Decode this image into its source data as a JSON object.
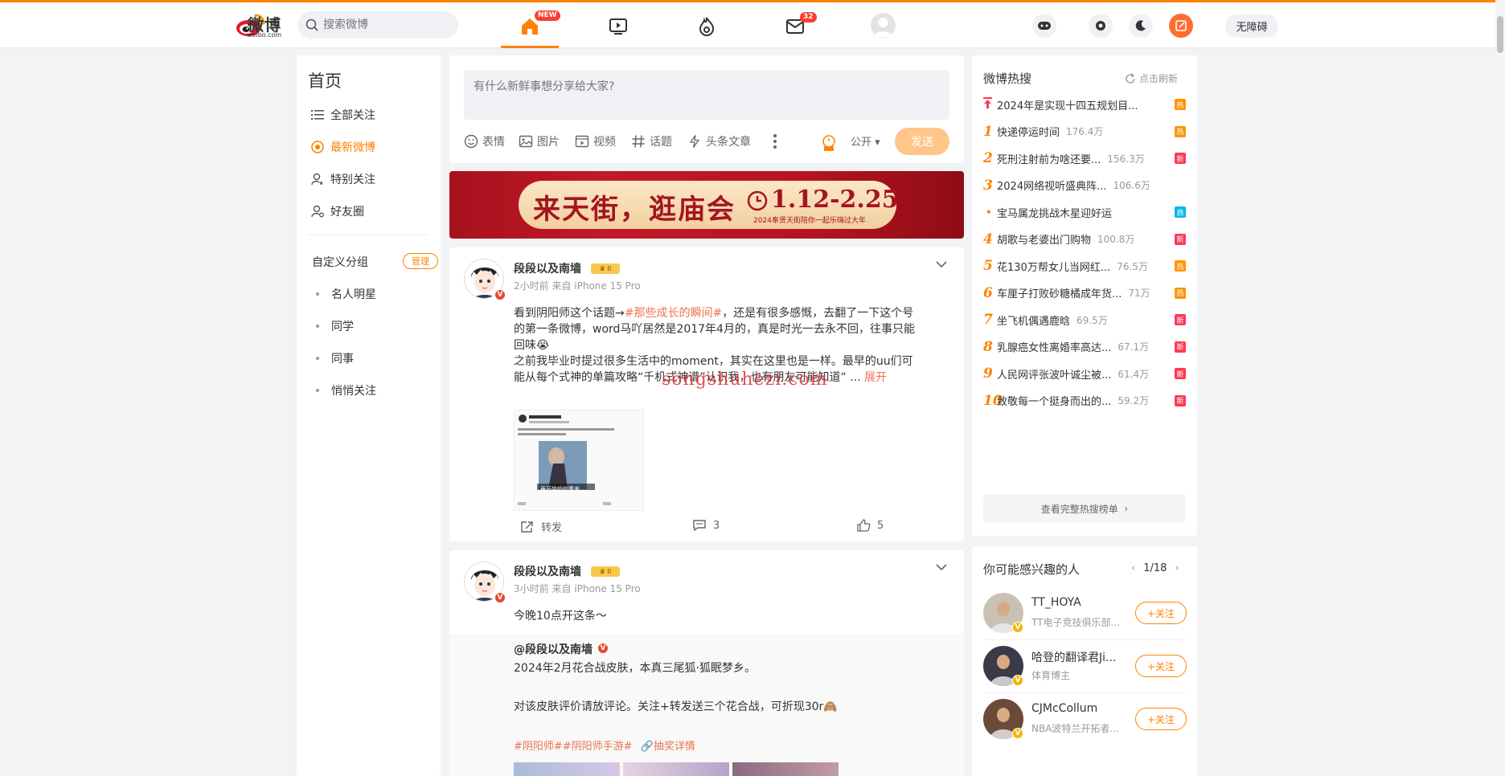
{
  "nav": {
    "logo_text": "微博",
    "logo_sub": "weibo.com",
    "search_placeholder": "搜索微博",
    "home_badge": "NEW",
    "mail_badge": "32",
    "accessibility": "无障碍"
  },
  "left": {
    "title": "首页",
    "menu": [
      {
        "label": "全部关注",
        "icon": "list-icon"
      },
      {
        "label": "最新微博",
        "icon": "latest-icon",
        "active": true
      },
      {
        "label": "特别关注",
        "icon": "user-star-icon"
      },
      {
        "label": "好友圈",
        "icon": "user-friends-icon"
      }
    ],
    "custom_group": "自定义分组",
    "manage": "管理",
    "groups": [
      "名人明星",
      "同学",
      "同事",
      "悄悄关注"
    ]
  },
  "composer": {
    "placeholder": "有什么新鲜事想分享给大家?",
    "tools": [
      "表情",
      "图片",
      "视频",
      "话题",
      "头条文章"
    ],
    "visibility": "公开",
    "send": "发送"
  },
  "banner": {
    "title": "来天街，逛庙会",
    "date": "1.12-2.25",
    "sub": "2024奉贤天街陪你一起乐嗨过大年"
  },
  "posts": [
    {
      "name": "段段以及南墙",
      "meta": "2小时前  来自 iPhone 15 Pro",
      "line1_pre": "看到阴阳师这个话题→",
      "line1_tag": "#那些成长的瞬间#",
      "line1_post": "，还是有很多感慨，去翻了一下这个号",
      "line2": "的第一条微博，word马吖居然是2017年4月的，真是时光一去永不回，往事只能",
      "line3": "回味😭",
      "line4": "之前我毕业时提过很多生活中的moment，其实在这里也是一样。最早的uu们可",
      "line5": "能从每个式神的单篇攻略“千机式神谱”认识我，也有朋友可能知道“ ...",
      "expand": "展开",
      "image_caption": "再开始炉炉重来",
      "repost": "转发",
      "comments": "3",
      "likes": "5"
    },
    {
      "name": "段段以及南墙",
      "meta": "3小时前  来自 iPhone 15 Pro",
      "text": "今晚10点开这条～",
      "quoted_name": "@段段以及南墙",
      "quoted_line1": "2024年2月花合战皮肤，本真三尾狐·狐眠梦乡。",
      "quoted_line2": "对该皮肤评价请放评论。关注+转发送三个花合战，可折现30r🙈",
      "quoted_tags": "#阴阳师##阴阳师手游#",
      "quoted_link": "抽奖详情"
    }
  ],
  "hot_search": {
    "title": "微博热搜",
    "refresh": "点击刷新",
    "items": [
      {
        "rank": "",
        "title": "2024年是实现十四五规划目...",
        "count": "",
        "tag": "热",
        "tag_color": "#ff9406"
      },
      {
        "rank": "1",
        "title": "快递停运时间",
        "count": "176.4万",
        "tag": "热",
        "tag_color": "#ff9406"
      },
      {
        "rank": "2",
        "title": "死刑注射前为啥还要...",
        "count": "156.3万",
        "tag": "新",
        "tag_color": "#ff3852"
      },
      {
        "rank": "3",
        "title": "2024网络视听盛典阵...",
        "count": "106.6万",
        "tag": "",
        "tag_color": ""
      },
      {
        "rank": "•",
        "title": "宝马属龙挑战木星迎好运",
        "count": "",
        "tag": "商",
        "tag_color": "#00b7ee"
      },
      {
        "rank": "4",
        "title": "胡歌与老婆出门购物",
        "count": "100.8万",
        "tag": "新",
        "tag_color": "#ff3852"
      },
      {
        "rank": "5",
        "title": "花130万帮女儿当网红...",
        "count": "76.5万",
        "tag": "热",
        "tag_color": "#ff9406"
      },
      {
        "rank": "6",
        "title": "车厘子打败砂糖橘成年货...",
        "count": "71万",
        "tag": "热",
        "tag_color": "#ff9406"
      },
      {
        "rank": "7",
        "title": "坐飞机偶遇鹿晗",
        "count": "69.5万",
        "tag": "新",
        "tag_color": "#ff3852"
      },
      {
        "rank": "8",
        "title": "乳腺癌女性离婚率高达...",
        "count": "67.1万",
        "tag": "新",
        "tag_color": "#ff3852"
      },
      {
        "rank": "9",
        "title": "人民网评张波叶诚尘被...",
        "count": "61.4万",
        "tag": "新",
        "tag_color": "#ff3852"
      },
      {
        "rank": "10",
        "title": "致敬每一个挺身而出的...",
        "count": "59.2万",
        "tag": "新",
        "tag_color": "#ff3852"
      }
    ],
    "more": "查看完整热搜榜单"
  },
  "recommend": {
    "title": "你可能感兴趣的人",
    "pager": "1/18",
    "people": [
      {
        "name": "TT_HOYA",
        "desc": "TT电子竞技俱乐部...",
        "follow": "+关注",
        "color": "#c9c2b4"
      },
      {
        "name": "哈登的翻译君Ji...",
        "desc": "体育博主",
        "follow": "+关注",
        "color": "#3a3a48"
      },
      {
        "name": "CJMcCollum",
        "desc": "NBA波特兰开拓者...",
        "follow": "+关注",
        "color": "#6b4a3a"
      }
    ]
  },
  "watermark": "songshuhezi.com"
}
